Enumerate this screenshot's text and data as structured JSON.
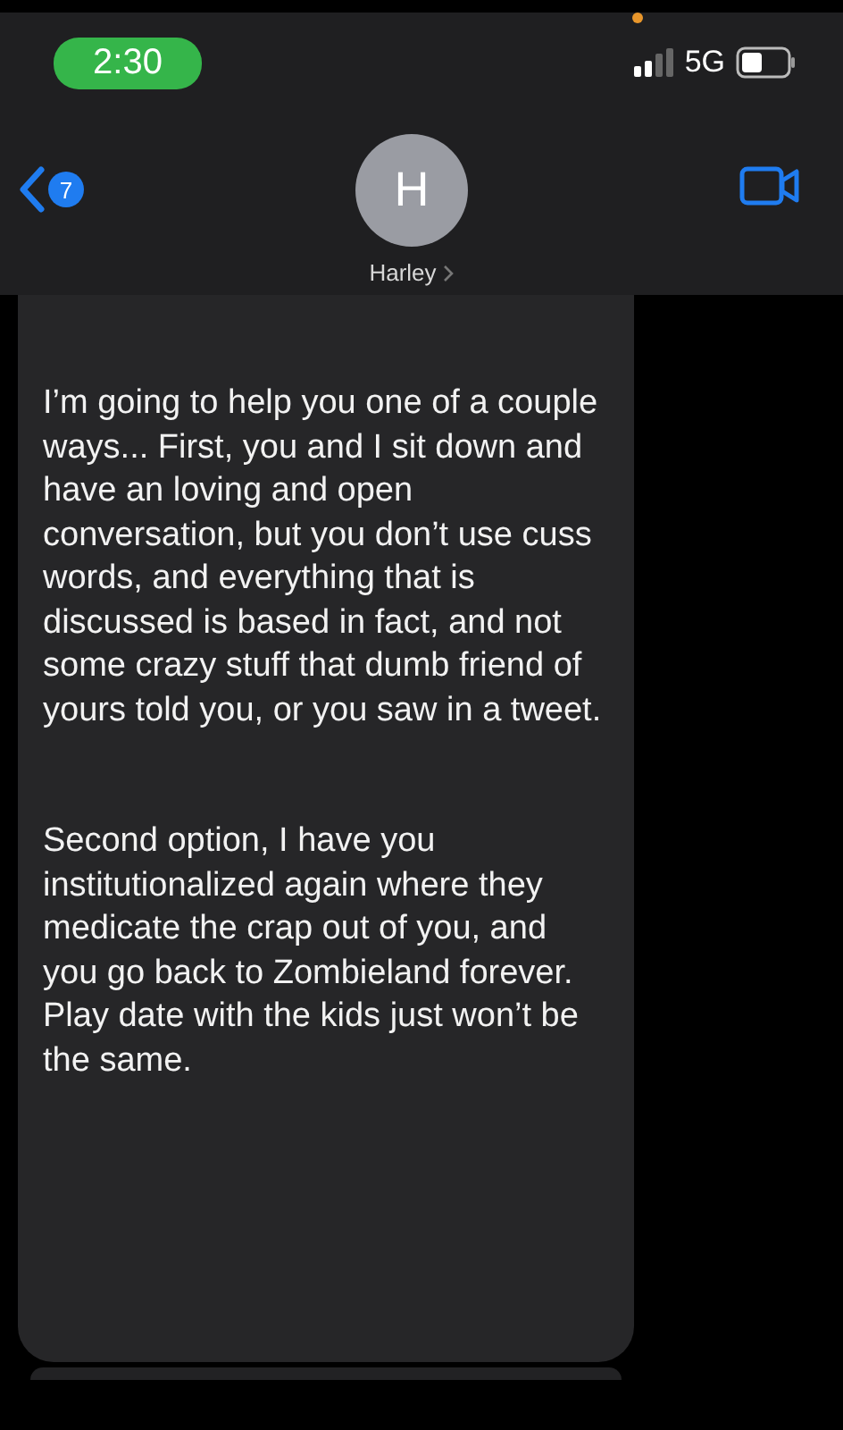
{
  "status_bar": {
    "time": "2:30",
    "network": "5G"
  },
  "header": {
    "unread_count": "7",
    "avatar_initial": "H",
    "contact_name": "Harley"
  },
  "messages": [
    {
      "paragraphs": [
        "I’m going to help you one of a couple ways... First, you and I sit down and have an loving and open  conversation, but you don’t use cuss words, and everything that is discussed is based in fact, and not some crazy stuff that dumb friend of yours told you, or you saw in a tweet.",
        "Second option, I have you institutionalized again where they medicate the crap out of you, and you go back to Zombieland forever. Play date with the kids just won’t be the same."
      ]
    }
  ]
}
